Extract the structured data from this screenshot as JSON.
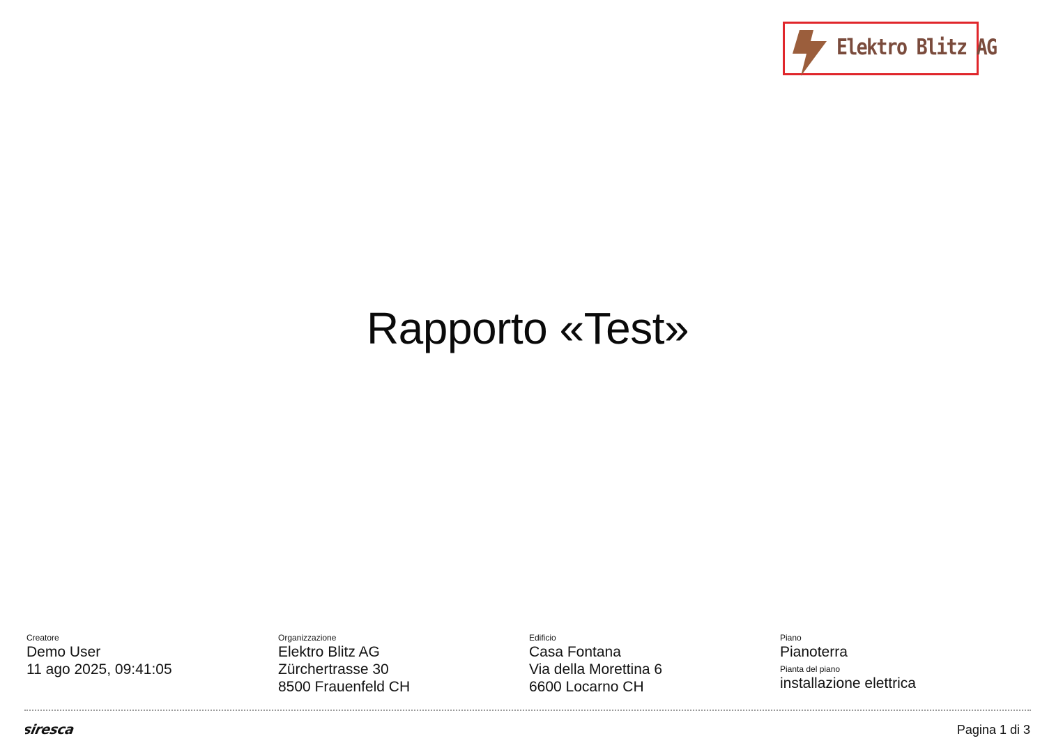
{
  "logo": {
    "company_name": "Elektro Blitz AG",
    "icon": "lightning-bolt-icon",
    "text_color": "#7a4b3c",
    "bolt_color": "#9b5e3c",
    "border_color": "#e0262b"
  },
  "report": {
    "title": "Rapporto «Test»"
  },
  "meta": {
    "creator": {
      "label": "Creatore",
      "name": "Demo User",
      "datetime": "11 ago 2025, 09:41:05"
    },
    "organization": {
      "label": "Organizzazione",
      "name": "Elektro Blitz AG",
      "street": "Zürchertrasse 30",
      "city": "8500 Frauenfeld CH"
    },
    "building": {
      "label": "Edificio",
      "name": "Casa Fontana",
      "street": "Via della Morettina 6",
      "city": "6600 Locarno CH"
    },
    "floor": {
      "label": "Piano",
      "name": "Pianoterra",
      "plan_label": "Pianta del piano",
      "plan_name": "installazione elettrica"
    }
  },
  "footer": {
    "brand": "siresca",
    "page": "Pagina 1 di 3"
  }
}
